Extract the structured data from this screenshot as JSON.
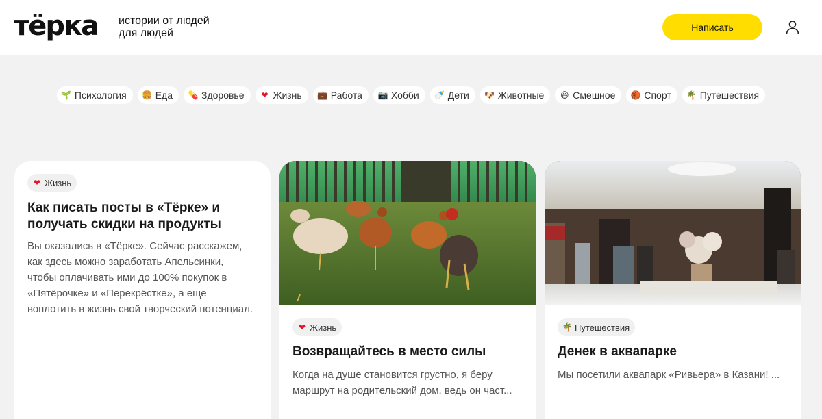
{
  "header": {
    "logo": "тёрка",
    "tagline": "истории от людей для людей",
    "write_button": "Написать"
  },
  "tags": [
    {
      "emoji": "🌱",
      "label": "Психология"
    },
    {
      "emoji": "🍔",
      "label": "Еда"
    },
    {
      "emoji": "💊",
      "label": "Здоровье"
    },
    {
      "emoji": "❤",
      "label": "Жизнь"
    },
    {
      "emoji": "💼",
      "label": "Работа"
    },
    {
      "emoji": "📷",
      "label": "Хобби"
    },
    {
      "emoji": "🍼",
      "label": "Дети"
    },
    {
      "emoji": "🐶",
      "label": "Животные"
    },
    {
      "emoji": "😆",
      "label": "Смешное"
    },
    {
      "emoji": "🏀",
      "label": "Спорт"
    },
    {
      "emoji": "🌴",
      "label": "Путешествия"
    }
  ],
  "cards": [
    {
      "category_emoji": "❤",
      "category": "Жизнь",
      "title": "Как писать посты в «Тёрке» и получать скидки на продукты",
      "excerpt": "Вы оказались в «Тёрке». Сейчас расскажем, как здесь можно заработать Апельсинки, чтобы оплачивать ими до 100% покупок в «Пятёрочке» и «Перекрёстке», а еще воплотить в жизнь свой творческий потенциал."
    },
    {
      "category_emoji": "❤",
      "category": "Жизнь",
      "title": "Возвращайтесь в место силы",
      "excerpt": "Когда на душе становится грустно, я беру маршрут на родительский дом, ведь он част..."
    },
    {
      "category_emoji": "🌴",
      "category": "Путешествия",
      "title": "Денек в аквапарке",
      "excerpt": "Мы посетили аквапарк «Ривьера» в Казани! ..."
    }
  ],
  "colors": {
    "accent": "#ffdd00",
    "background": "#f2f2f2",
    "card": "#ffffff"
  }
}
